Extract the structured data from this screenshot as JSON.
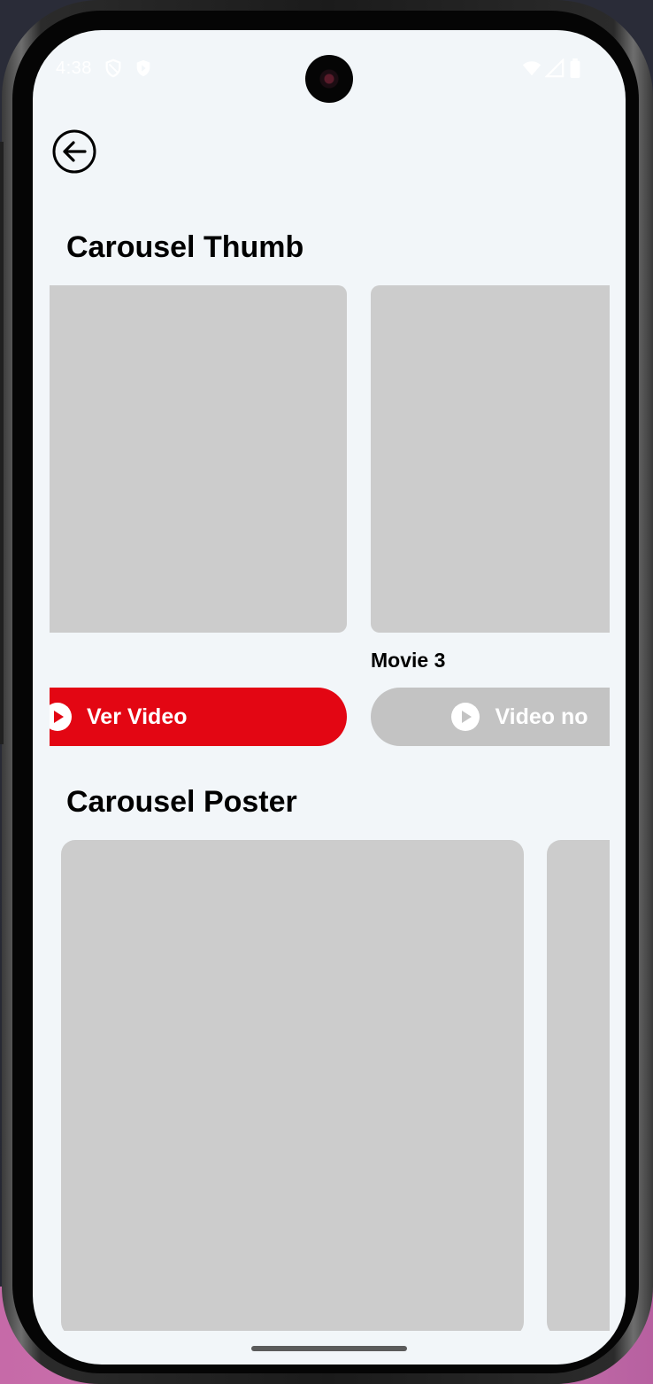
{
  "status_bar": {
    "time": "4:38"
  },
  "header": {
    "back_icon": "arrow-left-circle-icon"
  },
  "sections": {
    "thumb": {
      "title": "Carousel Thumb",
      "cards": [
        {
          "title": "",
          "button_label": "Ver Video",
          "button_state": "enabled",
          "button_color": "#e30613"
        },
        {
          "title": "Movie 3",
          "button_label": "Video no",
          "button_state": "disabled",
          "button_color": "#c3c3c3"
        }
      ]
    },
    "poster": {
      "title": "Carousel Poster"
    }
  },
  "colors": {
    "screen_background": "#f2f6f9",
    "placeholder": "#cccccc",
    "accent": "#e30613"
  }
}
